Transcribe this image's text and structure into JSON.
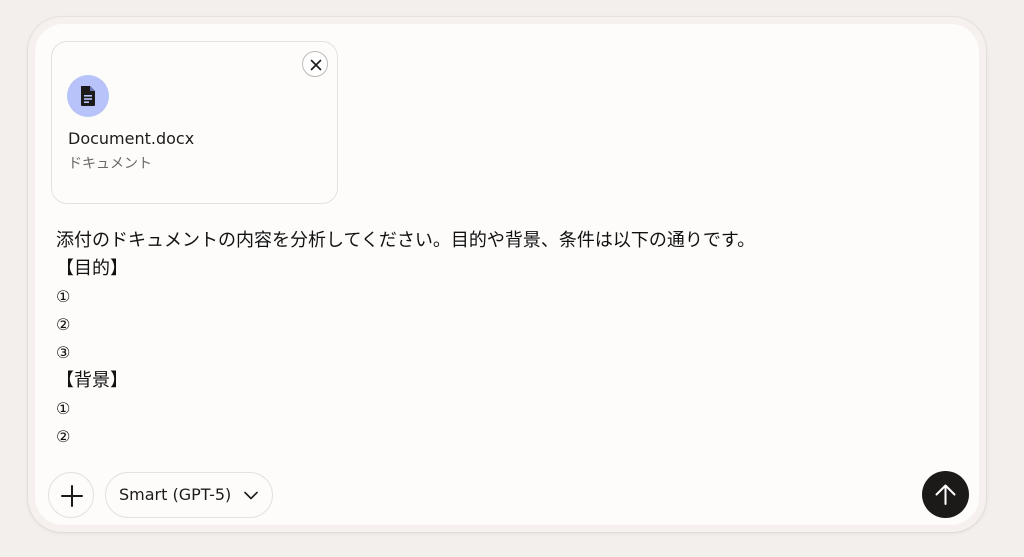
{
  "attachment": {
    "file_name": "Document.docx",
    "file_type": "ドキュメント",
    "icon": "document-icon",
    "remove_icon": "close-icon",
    "icon_bg_color": "#b7c3f9"
  },
  "message": {
    "lines": [
      "添付のドキュメントの内容を分析してください。目的や背景、条件は以下の通りです。",
      "【目的】",
      "①",
      "②",
      "③",
      "【背景】",
      "①",
      "②"
    ]
  },
  "toolbar": {
    "add_icon": "plus-icon",
    "model_label": "Smart (GPT-5)",
    "model_dropdown_icon": "chevron-down-icon",
    "send_icon": "arrow-up-icon",
    "send_button_color": "#1c1a19"
  }
}
